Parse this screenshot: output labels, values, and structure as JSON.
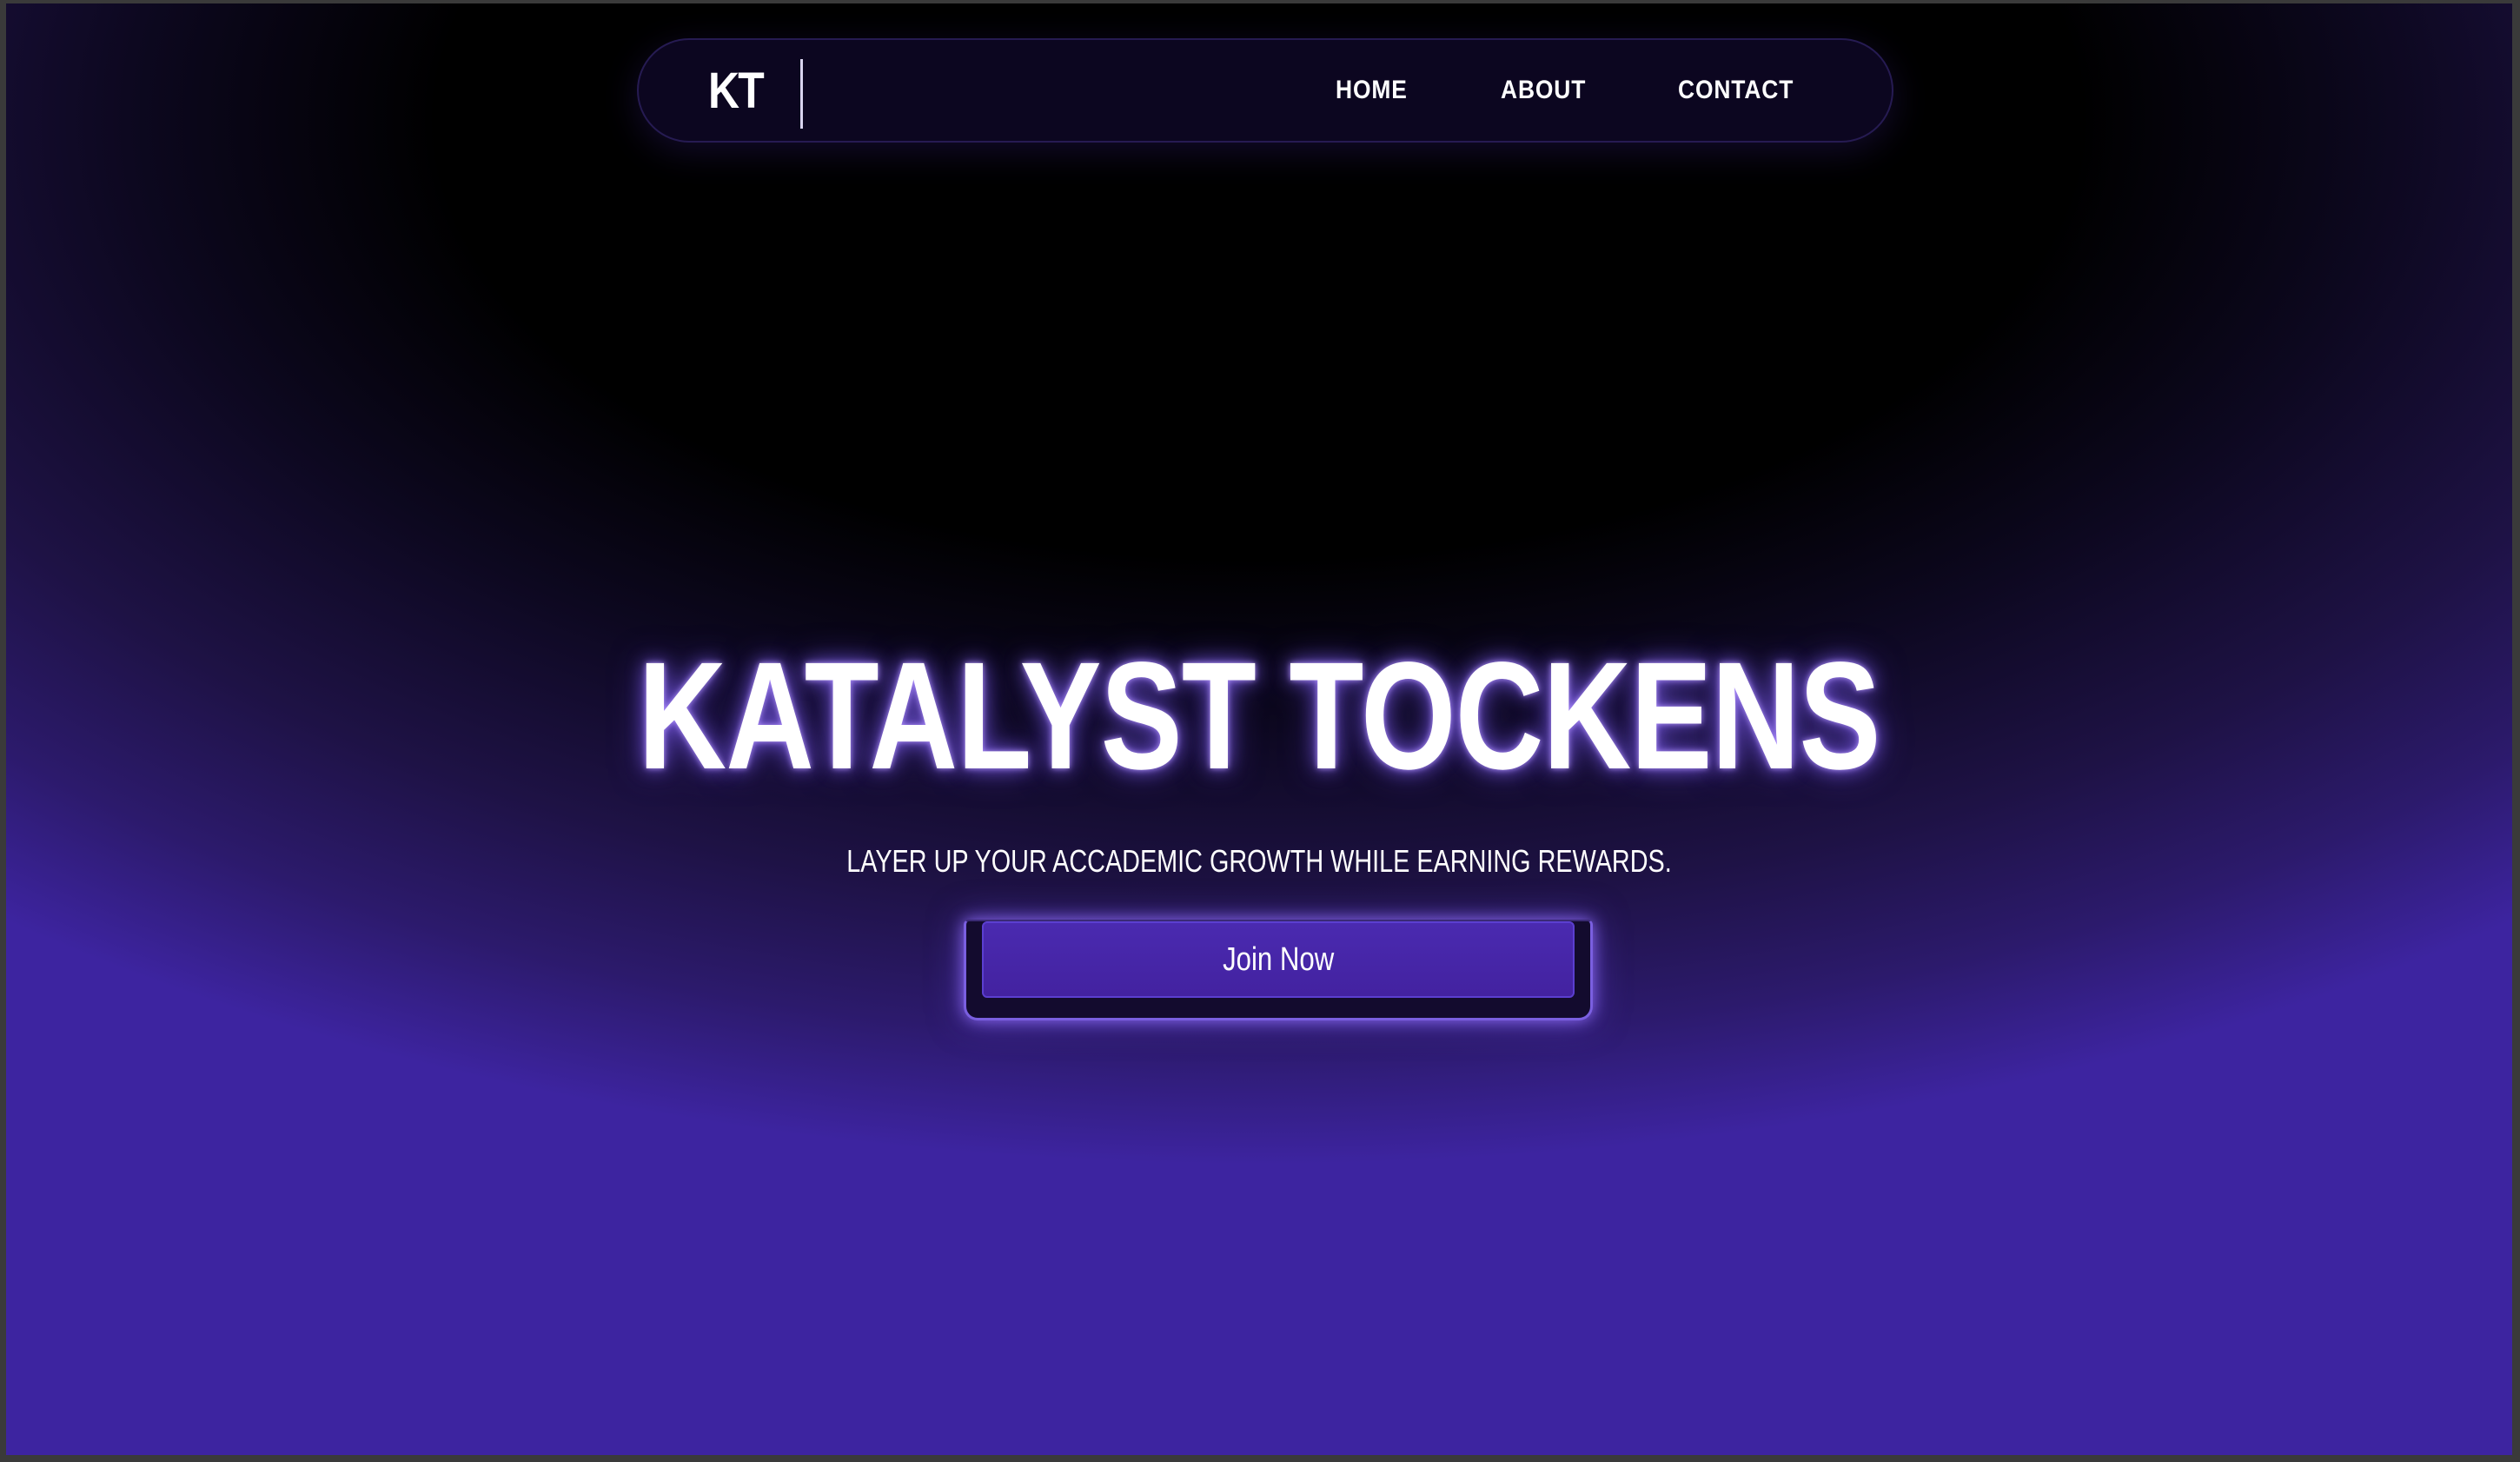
{
  "brand": {
    "logo_text": "KT"
  },
  "nav": {
    "items": [
      {
        "label": "HOME"
      },
      {
        "label": "ABOUT"
      },
      {
        "label": "CONTACT"
      }
    ]
  },
  "hero": {
    "title": "KATALYST TOCKENS",
    "subtitle": "LAYER UP YOUR ACCADEMIC GROWTH WHILE EARNING REWARDS.",
    "cta_label": "Join Now"
  },
  "colors": {
    "background_top": "#000000",
    "background_bottom": "#3d24a0",
    "navbar_bg": "#0c0620",
    "accent": "#4a2ab0",
    "glow": "#8c69ff",
    "text": "#ffffff"
  }
}
